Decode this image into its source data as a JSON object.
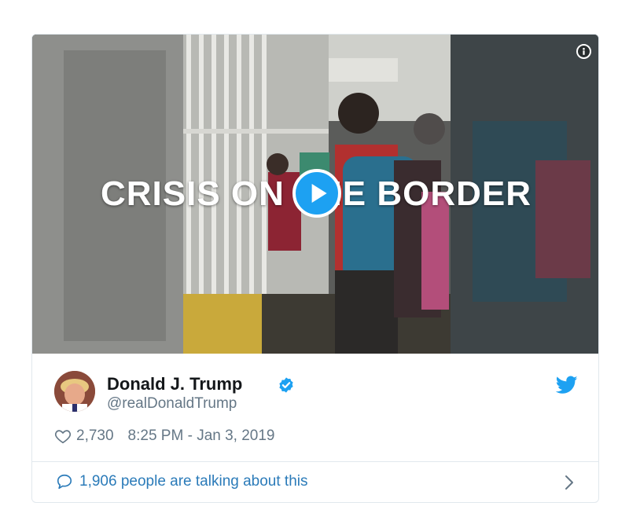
{
  "media": {
    "headline": "CRISIS ON THE BORDER",
    "info_icon": "info-icon",
    "play_icon": "play-icon"
  },
  "author": {
    "name": "Donald J. Trump",
    "handle": "@realDonaldTrump",
    "verified_icon": "verified-badge-icon",
    "platform_icon": "twitter-bird-icon"
  },
  "meta": {
    "likes": "2,730",
    "timestamp": "8:25 PM - Jan 3, 2019",
    "like_icon": "heart-icon"
  },
  "footer": {
    "talking": "1,906 people are talking about this",
    "talk_icon": "speech-bubble-icon",
    "chevron_icon": "chevron-right-icon"
  },
  "colors": {
    "accent": "#1da1f2",
    "link": "#2b7bb9",
    "secondary_text": "#657786",
    "primary_text": "#14171a",
    "border": "#e1e8ed"
  }
}
